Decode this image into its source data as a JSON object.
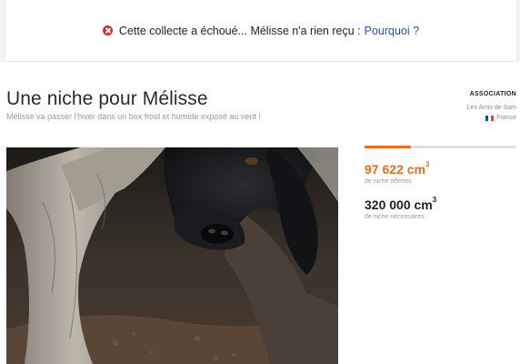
{
  "alert": {
    "message": "Cette collecte a échoué... Mélisse n'a rien reçu :",
    "link": "Pourquoi ?"
  },
  "campaign": {
    "title": "Une niche pour Mélisse",
    "subtitle": "Mélisse va passer l'hiver dans un box froid et humide exposé au vent !",
    "photo_alt": "Chien noir couché sous un tronc d'arbre"
  },
  "association": {
    "heading": "ASSOCIATION",
    "name": "Les Amis de Sam",
    "country": "France",
    "flag_colors": [
      "#0055a4",
      "#ffffff",
      "#ef4135"
    ]
  },
  "progress": {
    "fraction": 0.305,
    "color": "#f26a1b"
  },
  "stats": {
    "offered_value": "97 622 cm",
    "offered_exp": "3",
    "offered_label": "de niche offertes",
    "needed_value": "320 000 cm",
    "needed_exp": "3",
    "needed_label": "de niche nécessaires"
  }
}
